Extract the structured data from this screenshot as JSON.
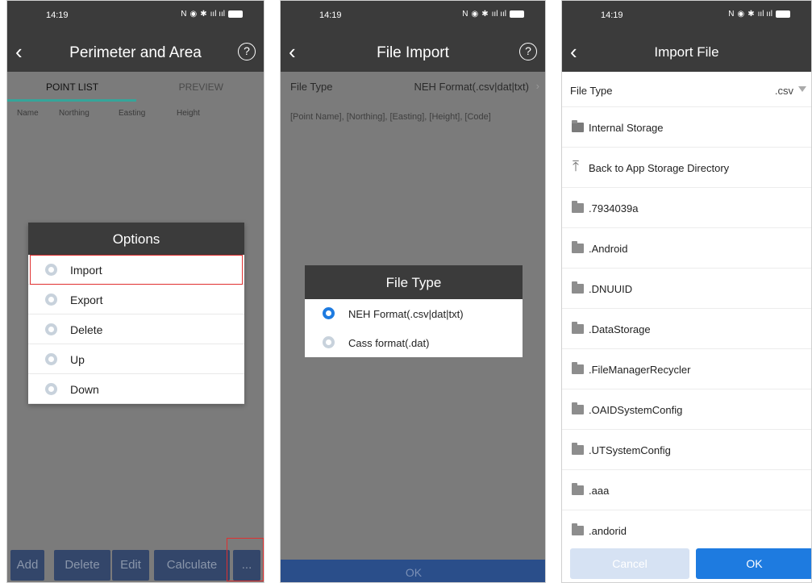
{
  "screen1": {
    "status": {
      "time": "14:19"
    },
    "title": "Perimeter and Area",
    "help_glyph": "?",
    "tabs": [
      {
        "label": "POINT LIST"
      },
      {
        "label": "PREVIEW"
      }
    ],
    "columns": [
      "Name",
      "Northing",
      "Easting",
      "Height"
    ],
    "dialog": {
      "title": "Options",
      "options": [
        {
          "label": "Import"
        },
        {
          "label": "Export"
        },
        {
          "label": "Delete"
        },
        {
          "label": "Up"
        },
        {
          "label": "Down"
        }
      ]
    },
    "buttons": {
      "add": "Add",
      "delete": "Delete",
      "edit": "Edit",
      "calculate": "Calculate",
      "more": "..."
    }
  },
  "screen2": {
    "status": {
      "time": "14:19"
    },
    "title": "File Import",
    "help_glyph": "?",
    "file_type_label": "File Type",
    "file_type_value": "NEH Format(.csv|dat|txt)",
    "format_hint": "[Point Name], [Northing], [Easting], [Height], [Code]",
    "dialog": {
      "title": "File Type",
      "options": [
        {
          "label": "NEH Format(.csv|dat|txt)",
          "selected": true
        },
        {
          "label": "Cass format(.dat)",
          "selected": false
        }
      ]
    },
    "ok_label": "OK"
  },
  "screen3": {
    "status": {
      "time": "14:19"
    },
    "title": "Import File",
    "file_type_label": "File Type",
    "file_type_value": ".csv",
    "storage_label": "Internal Storage",
    "back_label": "Back to App Storage Directory",
    "folders": [
      ".7934039a",
      ".Android",
      ".DNUUID",
      ".DataStorage",
      ".FileManagerRecycler",
      ".OAIDSystemConfig",
      ".UTSystemConfig",
      ".aaa",
      ".andorid"
    ],
    "cancel_label": "Cancel",
    "ok_label": "OK"
  },
  "colors": {
    "accent_blue": "#1e7be0",
    "teal": "#35a59a",
    "dark_bar": "#3b3b3b",
    "highlight_red": "#e03030"
  }
}
